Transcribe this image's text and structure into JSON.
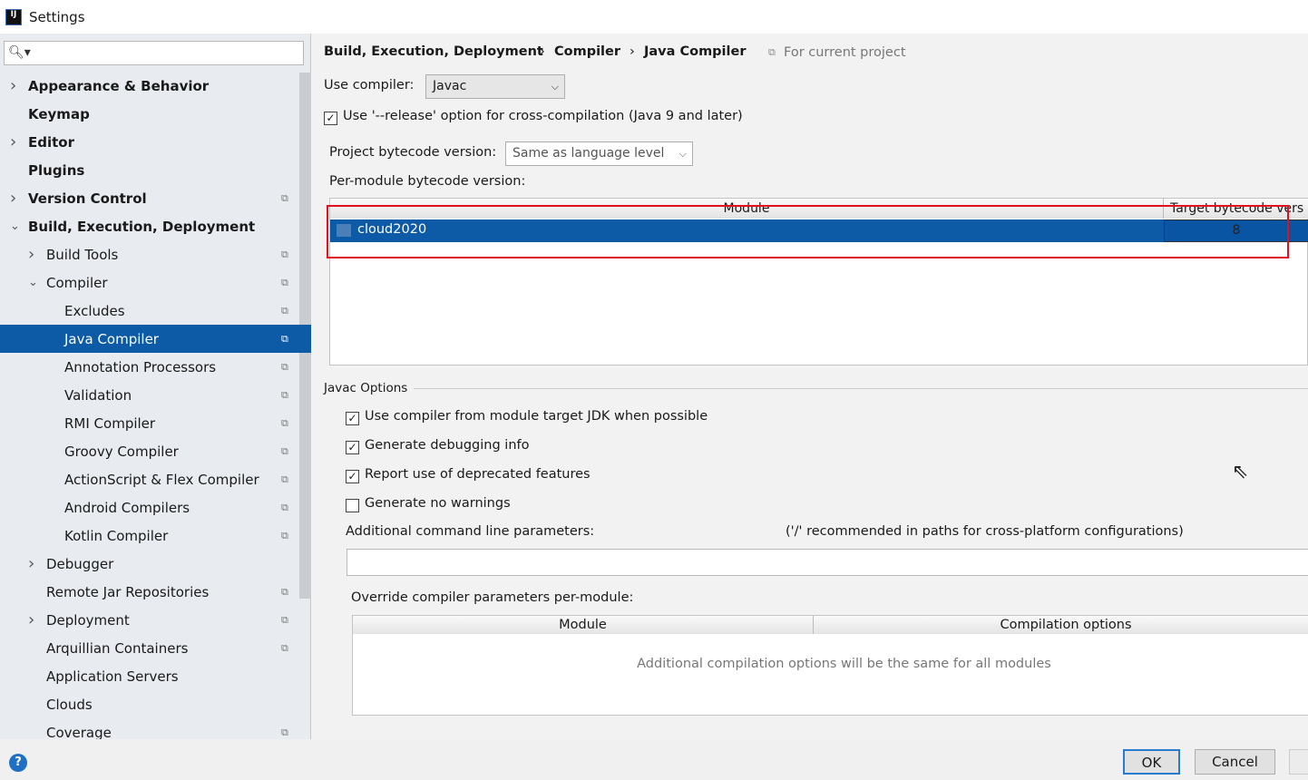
{
  "window": {
    "title": "Settings"
  },
  "sidebar": {
    "search_placeholder": "",
    "items": [
      {
        "label": "Appearance & Behavior",
        "bold": true,
        "level": 0,
        "arrow": "right",
        "copy": false
      },
      {
        "label": "Keymap",
        "bold": true,
        "level": 0,
        "arrow": "",
        "copy": false
      },
      {
        "label": "Editor",
        "bold": true,
        "level": 0,
        "arrow": "right",
        "copy": false
      },
      {
        "label": "Plugins",
        "bold": true,
        "level": 0,
        "arrow": "",
        "copy": false
      },
      {
        "label": "Version Control",
        "bold": true,
        "level": 0,
        "arrow": "right",
        "copy": true
      },
      {
        "label": "Build, Execution, Deployment",
        "bold": true,
        "level": 0,
        "arrow": "down",
        "copy": false
      },
      {
        "label": "Build Tools",
        "level": 1,
        "arrow": "right",
        "copy": true
      },
      {
        "label": "Compiler",
        "level": 1,
        "arrow": "down",
        "copy": true
      },
      {
        "label": "Excludes",
        "level": 2,
        "arrow": "",
        "copy": true
      },
      {
        "label": "Java Compiler",
        "level": 2,
        "arrow": "",
        "copy": true,
        "selected": true
      },
      {
        "label": "Annotation Processors",
        "level": 2,
        "arrow": "",
        "copy": true
      },
      {
        "label": "Validation",
        "level": 2,
        "arrow": "",
        "copy": true
      },
      {
        "label": "RMI Compiler",
        "level": 2,
        "arrow": "",
        "copy": true
      },
      {
        "label": "Groovy Compiler",
        "level": 2,
        "arrow": "",
        "copy": true
      },
      {
        "label": "ActionScript & Flex Compiler",
        "level": 2,
        "arrow": "",
        "copy": true
      },
      {
        "label": "Android Compilers",
        "level": 2,
        "arrow": "",
        "copy": true
      },
      {
        "label": "Kotlin Compiler",
        "level": 2,
        "arrow": "",
        "copy": true
      },
      {
        "label": "Debugger",
        "level": 1,
        "arrow": "right",
        "copy": false
      },
      {
        "label": "Remote Jar Repositories",
        "level": 1,
        "arrow": "",
        "copy": true
      },
      {
        "label": "Deployment",
        "level": 1,
        "arrow": "right",
        "copy": true
      },
      {
        "label": "Arquillian Containers",
        "level": 1,
        "arrow": "",
        "copy": true
      },
      {
        "label": "Application Servers",
        "level": 1,
        "arrow": "",
        "copy": false
      },
      {
        "label": "Clouds",
        "level": 1,
        "arrow": "",
        "copy": false
      },
      {
        "label": "Coverage",
        "level": 1,
        "arrow": "",
        "copy": true
      }
    ]
  },
  "breadcrumb": {
    "part1": "Build, Execution, Deployment",
    "part2": "Compiler",
    "part3": "Java Compiler",
    "sep": "›",
    "scope": "For current project"
  },
  "compiler": {
    "use_label": "Use compiler:",
    "use_value": "Javac",
    "release_label": "Use '--release' option for cross-compilation (Java 9 and later)",
    "release_checked": true,
    "bytecode_label": "Project bytecode version:",
    "bytecode_value": "Same as language level",
    "per_module_label": "Per-module bytecode version:",
    "table": {
      "col_module": "Module",
      "col_target": "Target bytecode vers",
      "rows": [
        {
          "module": "cloud2020",
          "target": "8"
        }
      ]
    }
  },
  "javac": {
    "section": "Javac Options",
    "options": [
      {
        "label": "Use compiler from module target JDK when possible",
        "checked": true
      },
      {
        "label": "Generate debugging info",
        "checked": true
      },
      {
        "label": "Report use of deprecated features",
        "checked": true
      },
      {
        "label": "Generate no warnings",
        "checked": false
      }
    ],
    "params_label": "Additional command line parameters:",
    "params_hint": "('/' recommended in paths for cross-platform configurations)",
    "params_value": "",
    "override_label": "Override compiler parameters per-module:",
    "override_col_module": "Module",
    "override_col_options": "Compilation options",
    "override_empty": "Additional compilation options will be the same for all modules"
  },
  "footer": {
    "help": "?",
    "ok": "OK",
    "cancel": "Cancel"
  }
}
